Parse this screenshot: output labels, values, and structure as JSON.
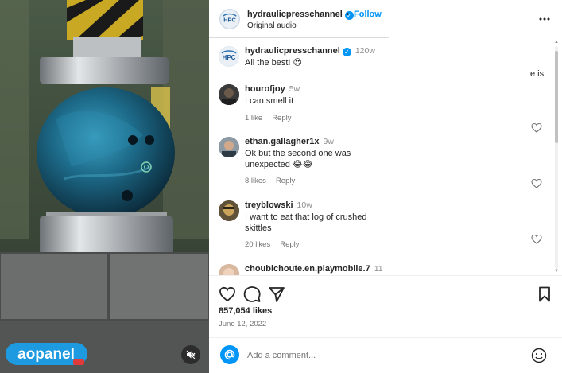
{
  "post": {
    "username": "hydraulicpressechannel",
    "username_display": "hydraulicpresschannel",
    "follow_label": "Follow",
    "audio": "Original audio",
    "avatar_text": "HPC"
  },
  "caption": {
    "username": "hydraulicpresschannel",
    "time": "120w",
    "text": "All the best! 😍"
  },
  "clipped_text": "e is",
  "comments": [
    {
      "username": "hourofjoy",
      "time": "5w",
      "text": "I can smell it",
      "likes": "1 like",
      "reply": "Reply"
    },
    {
      "username": "ethan.gallagher1x",
      "time": "9w",
      "text": "Ok but the second one was unexpected 😂😂",
      "likes": "8 likes",
      "reply": "Reply"
    },
    {
      "username": "treyblowski",
      "time": "10w",
      "text": "I want to eat that log of crushed skittles",
      "likes": "20 likes",
      "reply": "Reply"
    },
    {
      "username": "choubichoute.en.playmobile.7",
      "time": "11"
    }
  ],
  "engagement": {
    "likes": "857,054 likes",
    "date": "June 12, 2022"
  },
  "composer": {
    "placeholder": "Add a comment..."
  },
  "watermark": {
    "text": "aopanel",
    "sub": "•••"
  },
  "icons": {
    "more": "more-horizontal-icon",
    "like": "heart-icon",
    "comment": "comment-bubble-icon",
    "share": "paper-plane-icon",
    "save": "bookmark-icon",
    "mute": "speaker-muted-icon",
    "emoji": "smiley-icon"
  },
  "colors": {
    "accent": "#0095f6",
    "muted_text": "#737373",
    "text": "#262626"
  }
}
